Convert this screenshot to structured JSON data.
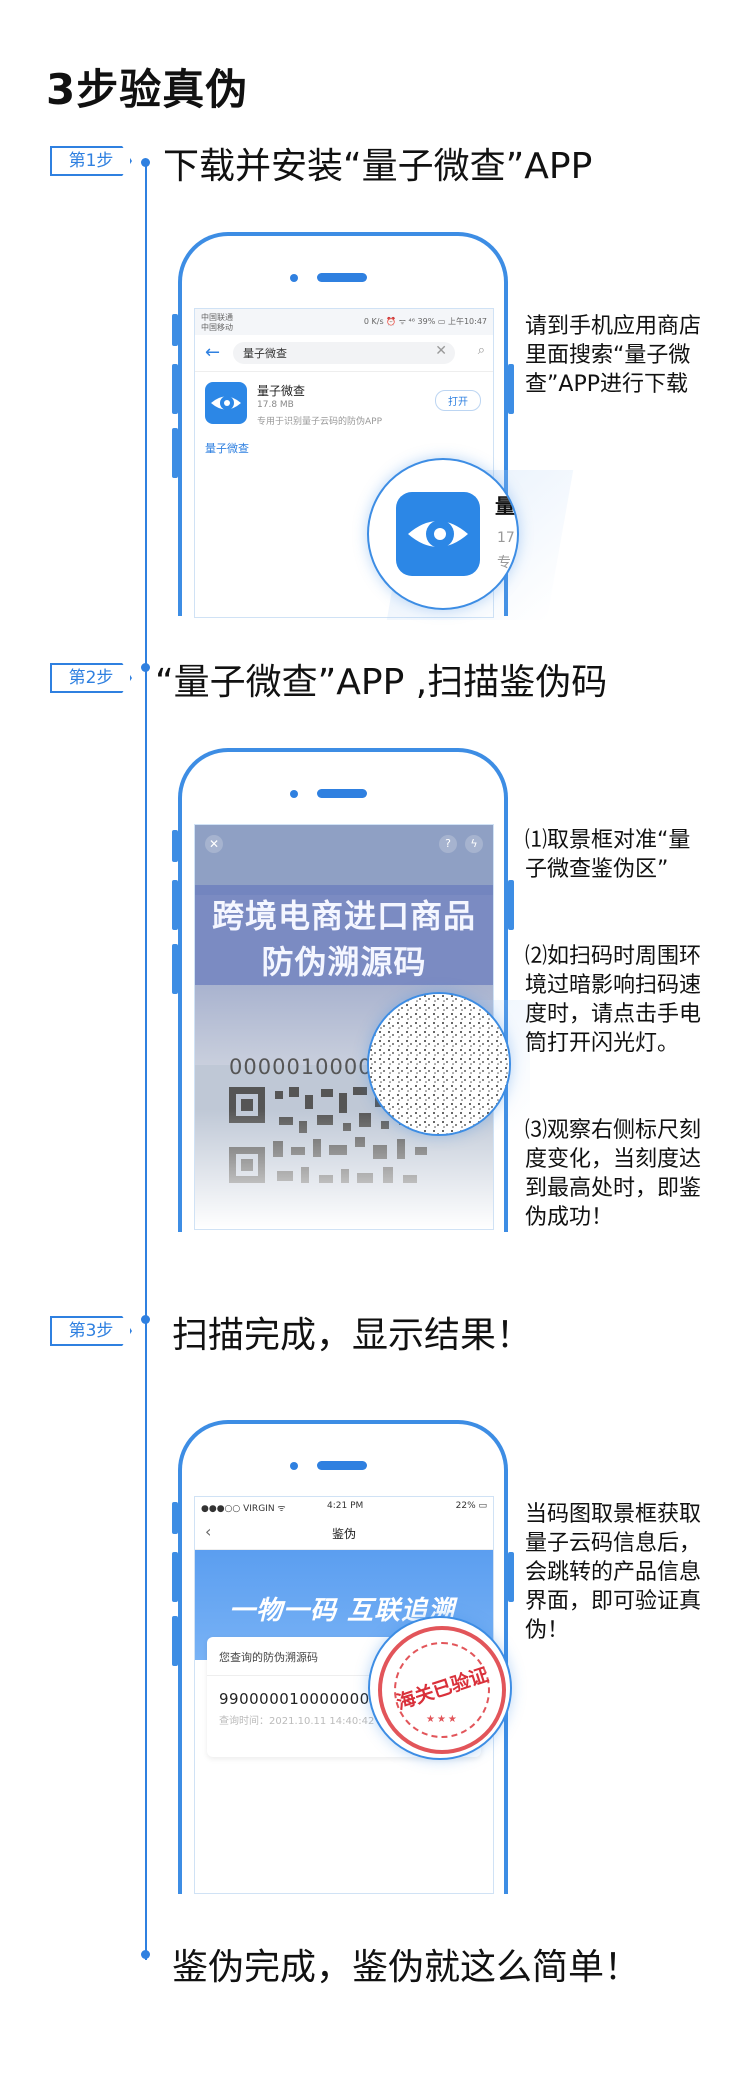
{
  "page_title": "3步验真伪",
  "steps": [
    {
      "badge": "第1步",
      "title": "下载并安装“量子微查”APP",
      "description": "请到手机应用商店里面搜索“量子微查”APP进行下载",
      "screen": {
        "status_left_1": "中国联通",
        "status_left_2": "中国移动",
        "status_right": "0 K/s ⏰ ᯤ ⁴⁶ 39% ▭ 上午10:47",
        "search_value": "量子微查",
        "app_name": "量子微查",
        "app_size": "17.8 MB",
        "app_desc": "专用于识别量子云码的防伪APP",
        "open_button": "打开",
        "section_label": "量子微查",
        "zoom_name": "量",
        "zoom_size": "17",
        "zoom_desc": "专"
      }
    },
    {
      "badge": "第2步",
      "title": "“量子微查”APP ,扫描鉴伪码",
      "description_1": "⑴取景框对准“量子微查鉴伪区”",
      "description_2": "⑵如扫码时周围环境过暗影响扫码速度时，请点击手电筒打开闪光灯。",
      "description_3": "⑶观察右侧标尺刻度变化，当刻度达到最高处时，即鉴伪成功！",
      "screen": {
        "banner_line_1": "跨境电商进口商品",
        "banner_line_2": "防伪溯源码",
        "code_number": "0000010000"
      }
    },
    {
      "badge": "第3步",
      "title": "扫描完成，显示结果！",
      "description": "当码图取景框获取量子云码信息后，会跳转的产品信息界面，即可验证真伪！",
      "screen": {
        "carrier": "●●●○○ VIRGIN ᯤ",
        "time": "4:21 PM",
        "battery": "22% ▭",
        "nav_title": "鉴伪",
        "slogan": "一物一码 互联追溯",
        "card_title": "您查询的防伪溯源码",
        "code": "990000010000000000",
        "query_time": "查询时间：2021.10.11 14:40:42",
        "stamp_text": "海关已验证"
      }
    }
  ],
  "final_text": "鉴伪完成，鉴伪就这么简单！",
  "colors": {
    "accent": "#2f80e0",
    "phone_border": "#3d8de4"
  }
}
